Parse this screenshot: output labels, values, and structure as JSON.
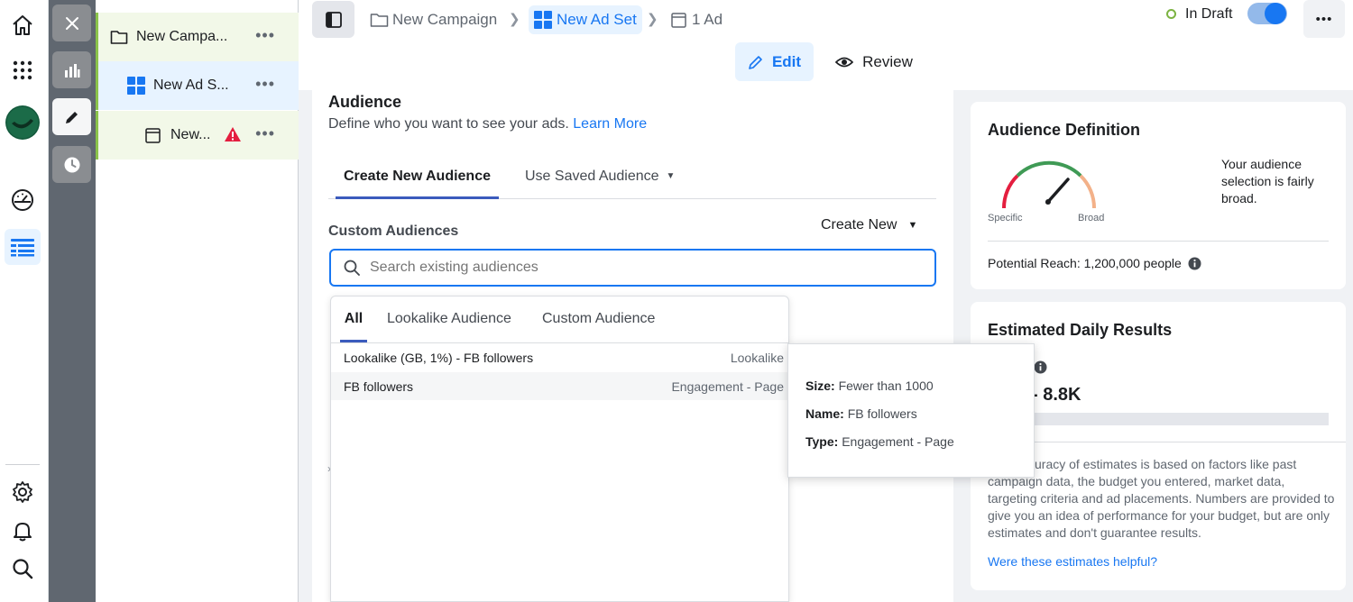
{
  "breadcrumb": {
    "campaign": "New Campaign",
    "ad_set": "New Ad Set",
    "ad": "1 Ad"
  },
  "status": {
    "label": "In Draft"
  },
  "mode_tabs": {
    "edit": "Edit",
    "review": "Review"
  },
  "tree": {
    "campaign": "New Campa...",
    "ad_set": "New Ad S...",
    "ad": "New..."
  },
  "audience": {
    "title": "Audience",
    "description": "Define who you want to see your ads.",
    "learn_more": "Learn More",
    "tabs": {
      "create_new": "Create New Audience",
      "use_saved": "Use Saved Audience"
    },
    "custom_audiences_label": "Custom Audiences",
    "create_new_label": "Create New",
    "search_placeholder": "Search existing audiences"
  },
  "dropdown": {
    "tabs": {
      "all": "All",
      "lookalike": "Lookalike Audience",
      "custom": "Custom Audience"
    },
    "rows": [
      {
        "name": "Lookalike (GB, 1%) - FB followers",
        "type": "Lookalike"
      },
      {
        "name": "FB followers",
        "type": "Engagement - Page"
      }
    ]
  },
  "tooltip": {
    "size_label": "Size:",
    "size_value": "Fewer than 1000",
    "name_label": "Name:",
    "name_value": "FB followers",
    "type_label": "Type:",
    "type_value": "Engagement - Page"
  },
  "audience_definition": {
    "title": "Audience Definition",
    "gauge_left": "Specific",
    "gauge_right": "Broad",
    "summary": "Your audience selection is fairly broad.",
    "potential_reach": "Potential Reach: 1,200,000 people"
  },
  "estimated_daily": {
    "title": "Estimated Daily Results",
    "range_value": "- 8.8K",
    "disclaimer": "uracy of estimates is based on factors like past campaign data, the budget you entered, market data, targeting criteria and ad placements. Numbers are provided to give you an idea of performance for your budget, but are only estimates and don't guarantee results.",
    "helpful_link": "Were these estimates helpful?"
  },
  "colors": {
    "accent": "#1877f2",
    "draft_green": "#7cb342",
    "warning_red": "#e41e3f"
  }
}
